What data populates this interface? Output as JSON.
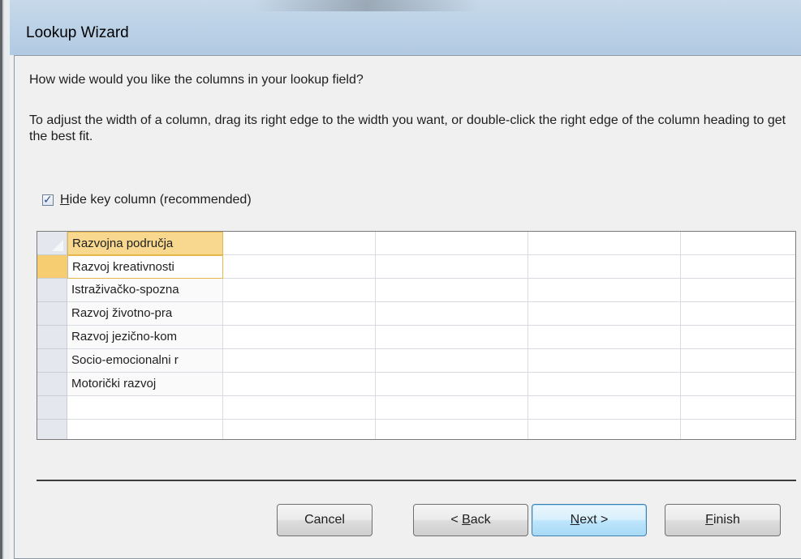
{
  "window": {
    "title": "Lookup Wizard"
  },
  "prompt": {
    "question": "How wide would you like the columns in your lookup field?",
    "instructions": "To adjust the width of a column, drag its right edge to the width you want, or double-click the right edge of the column heading to get the best fit."
  },
  "hide_key": {
    "checked": true,
    "label_mnemonic": "H",
    "label_rest": "ide key column (recommended)"
  },
  "grid": {
    "header": "Razvojna područja",
    "rows": [
      "Razvoj kreativnosti",
      "Istraživačko-spozna",
      "Razvoj životno-pra",
      "Razvoj jezično-kom",
      "Socio-emocionalni r",
      "Motorički razvoj"
    ]
  },
  "buttons": {
    "cancel": "Cancel",
    "back_prefix": "< ",
    "back_mnemonic": "B",
    "back_rest": "ack",
    "next_mnemonic": "N",
    "next_rest": "ext >",
    "finish_mnemonic": "F",
    "finish_rest": "inish"
  }
}
